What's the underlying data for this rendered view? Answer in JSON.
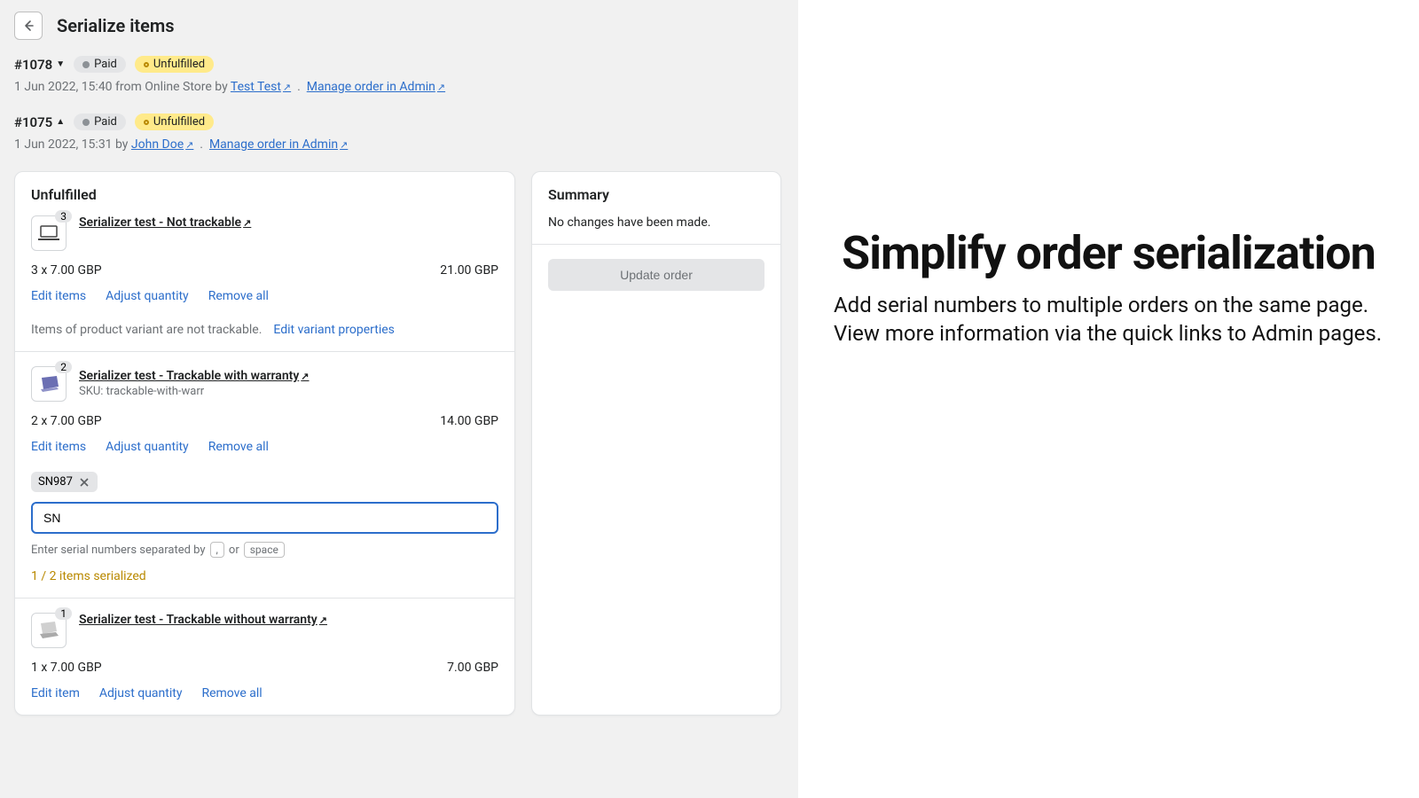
{
  "page": {
    "title": "Serialize items"
  },
  "orders": [
    {
      "num": "#1078",
      "paid": "Paid",
      "unf": "Unfulfilled",
      "meta_prefix": "1 Jun 2022, 15:40 from Online Store by ",
      "author": "Test Test",
      "manage": "Manage order in Admin"
    },
    {
      "num": "#1075",
      "paid": "Paid",
      "unf": "Unfulfilled",
      "meta_prefix": "1 Jun 2022, 15:31 by ",
      "author": "John Doe",
      "manage": "Manage order in Admin"
    }
  ],
  "unfulfilled": {
    "title": "Unfulfilled"
  },
  "items": [
    {
      "qty": "3",
      "title": "Serializer test - Not trackable",
      "sku": "",
      "price_left": "3 x 7.00 GBP",
      "price_right": "21.00 GBP",
      "edit": "Edit items",
      "adjust": "Adjust quantity",
      "remove": "Remove all",
      "note": "Items of product variant are not trackable.",
      "note_action": "Edit variant properties"
    },
    {
      "qty": "2",
      "title": "Serializer test - Trackable with warranty",
      "sku": "SKU: trackable-with-warr",
      "price_left": "2 x 7.00 GBP",
      "price_right": "14.00 GBP",
      "edit": "Edit items",
      "adjust": "Adjust quantity",
      "remove": "Remove all",
      "tag": "SN987",
      "input": "SN",
      "hint_prefix": "Enter serial numbers separated by ",
      "hint_comma": ",",
      "hint_or": "or",
      "hint_space": "space",
      "serialized": "1 / 2 items serialized"
    },
    {
      "qty": "1",
      "title": "Serializer test - Trackable without warranty",
      "sku": "",
      "price_left": "1 x 7.00 GBP",
      "price_right": "7.00 GBP",
      "edit": "Edit item",
      "adjust": "Adjust quantity",
      "remove": "Remove all"
    }
  ],
  "summary": {
    "title": "Summary",
    "msg": "No changes have been made.",
    "btn": "Update order"
  },
  "marketing": {
    "title": "Simplify order serialization",
    "sub": "Add serial numbers to multiple orders on the same page. View more information via the quick links to Admin pages."
  }
}
